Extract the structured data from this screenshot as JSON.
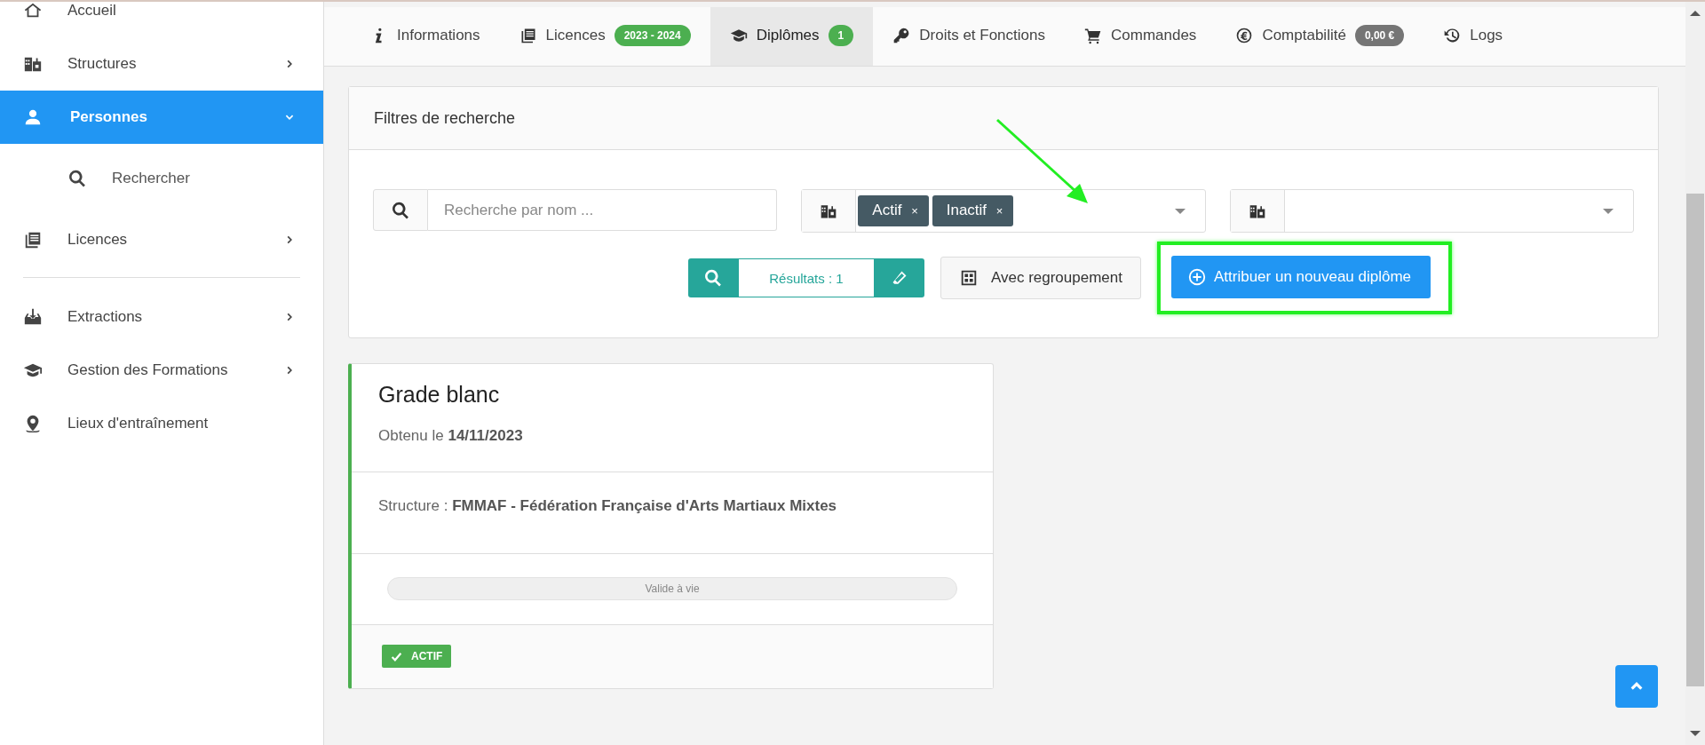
{
  "sidebar": {
    "sections": [
      {
        "items": [
          {
            "label": "Accueil",
            "selected": false
          },
          {
            "label": "Structures",
            "selected": false,
            "expanded": false
          },
          {
            "label": "Personnes",
            "selected": true,
            "expanded": true,
            "children": [
              {
                "label": "Rechercher",
                "selected": false
              }
            ]
          },
          {
            "label": "Licences",
            "selected": false,
            "expanded": false
          }
        ]
      },
      {
        "items": [
          {
            "label": "Extractions",
            "selected": false,
            "expanded": false
          },
          {
            "label": "Gestion des Formations",
            "selected": false,
            "expanded": false
          },
          {
            "label": "Lieux d'entraînement",
            "selected": false
          }
        ]
      }
    ]
  },
  "tabs": [
    {
      "label": "Informations",
      "selected": false
    },
    {
      "label": "Licences",
      "selected": false,
      "badge": {
        "text": "2023 - 2024",
        "color": "#4caf50"
      }
    },
    {
      "label": "Diplômes",
      "selected": true,
      "badge": {
        "text": "1",
        "color": "#4caf50"
      }
    },
    {
      "label": "Droits et Fonctions",
      "selected": false
    },
    {
      "label": "Commandes",
      "selected": false
    },
    {
      "label": "Comptabilité",
      "selected": false,
      "badge": {
        "text": "0,00 €",
        "color": "#757575"
      }
    },
    {
      "label": "Logs",
      "selected": false
    }
  ],
  "filters": {
    "title": "Filtres de recherche",
    "search": {
      "placeholder": "Recherche par nom ..."
    },
    "status_select": {
      "tags": [
        {
          "label": "Actif",
          "remove": "×"
        },
        {
          "label": "Inactif",
          "remove": "×"
        }
      ]
    },
    "results": "Résultats : 1",
    "grouping_button": "Avec regroupement",
    "add_button": {
      "label": "Attribuer un nouveau diplôme",
      "highlighted": true
    }
  },
  "diplomas": [
    {
      "title": "Grade blanc",
      "obtained": "Obtenu le **14/11/2023**",
      "structure": "Structure : **FMMAF - Fédération Française d'Arts Martiaux Mixtes**",
      "validity": "Valide à vie",
      "status": "ACTIF",
      "active": true
    }
  ]
}
